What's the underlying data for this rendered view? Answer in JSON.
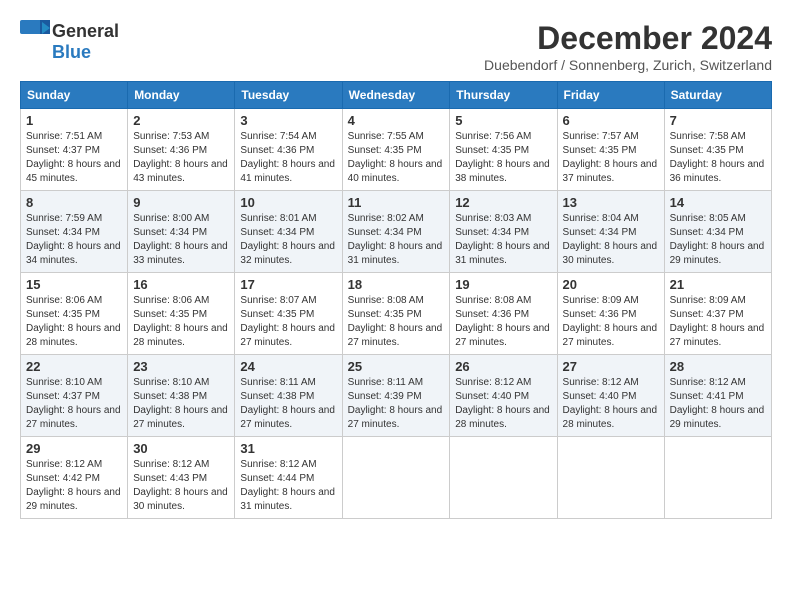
{
  "logo": {
    "general": "General",
    "blue": "Blue"
  },
  "title": {
    "month": "December 2024",
    "location": "Duebendorf / Sonnenberg, Zurich, Switzerland"
  },
  "headers": [
    "Sunday",
    "Monday",
    "Tuesday",
    "Wednesday",
    "Thursday",
    "Friday",
    "Saturday"
  ],
  "weeks": [
    [
      {
        "day": "1",
        "sunrise": "Sunrise: 7:51 AM",
        "sunset": "Sunset: 4:37 PM",
        "daylight": "Daylight: 8 hours and 45 minutes."
      },
      {
        "day": "2",
        "sunrise": "Sunrise: 7:53 AM",
        "sunset": "Sunset: 4:36 PM",
        "daylight": "Daylight: 8 hours and 43 minutes."
      },
      {
        "day": "3",
        "sunrise": "Sunrise: 7:54 AM",
        "sunset": "Sunset: 4:36 PM",
        "daylight": "Daylight: 8 hours and 41 minutes."
      },
      {
        "day": "4",
        "sunrise": "Sunrise: 7:55 AM",
        "sunset": "Sunset: 4:35 PM",
        "daylight": "Daylight: 8 hours and 40 minutes."
      },
      {
        "day": "5",
        "sunrise": "Sunrise: 7:56 AM",
        "sunset": "Sunset: 4:35 PM",
        "daylight": "Daylight: 8 hours and 38 minutes."
      },
      {
        "day": "6",
        "sunrise": "Sunrise: 7:57 AM",
        "sunset": "Sunset: 4:35 PM",
        "daylight": "Daylight: 8 hours and 37 minutes."
      },
      {
        "day": "7",
        "sunrise": "Sunrise: 7:58 AM",
        "sunset": "Sunset: 4:35 PM",
        "daylight": "Daylight: 8 hours and 36 minutes."
      }
    ],
    [
      {
        "day": "8",
        "sunrise": "Sunrise: 7:59 AM",
        "sunset": "Sunset: 4:34 PM",
        "daylight": "Daylight: 8 hours and 34 minutes."
      },
      {
        "day": "9",
        "sunrise": "Sunrise: 8:00 AM",
        "sunset": "Sunset: 4:34 PM",
        "daylight": "Daylight: 8 hours and 33 minutes."
      },
      {
        "day": "10",
        "sunrise": "Sunrise: 8:01 AM",
        "sunset": "Sunset: 4:34 PM",
        "daylight": "Daylight: 8 hours and 32 minutes."
      },
      {
        "day": "11",
        "sunrise": "Sunrise: 8:02 AM",
        "sunset": "Sunset: 4:34 PM",
        "daylight": "Daylight: 8 hours and 31 minutes."
      },
      {
        "day": "12",
        "sunrise": "Sunrise: 8:03 AM",
        "sunset": "Sunset: 4:34 PM",
        "daylight": "Daylight: 8 hours and 31 minutes."
      },
      {
        "day": "13",
        "sunrise": "Sunrise: 8:04 AM",
        "sunset": "Sunset: 4:34 PM",
        "daylight": "Daylight: 8 hours and 30 minutes."
      },
      {
        "day": "14",
        "sunrise": "Sunrise: 8:05 AM",
        "sunset": "Sunset: 4:34 PM",
        "daylight": "Daylight: 8 hours and 29 minutes."
      }
    ],
    [
      {
        "day": "15",
        "sunrise": "Sunrise: 8:06 AM",
        "sunset": "Sunset: 4:35 PM",
        "daylight": "Daylight: 8 hours and 28 minutes."
      },
      {
        "day": "16",
        "sunrise": "Sunrise: 8:06 AM",
        "sunset": "Sunset: 4:35 PM",
        "daylight": "Daylight: 8 hours and 28 minutes."
      },
      {
        "day": "17",
        "sunrise": "Sunrise: 8:07 AM",
        "sunset": "Sunset: 4:35 PM",
        "daylight": "Daylight: 8 hours and 27 minutes."
      },
      {
        "day": "18",
        "sunrise": "Sunrise: 8:08 AM",
        "sunset": "Sunset: 4:35 PM",
        "daylight": "Daylight: 8 hours and 27 minutes."
      },
      {
        "day": "19",
        "sunrise": "Sunrise: 8:08 AM",
        "sunset": "Sunset: 4:36 PM",
        "daylight": "Daylight: 8 hours and 27 minutes."
      },
      {
        "day": "20",
        "sunrise": "Sunrise: 8:09 AM",
        "sunset": "Sunset: 4:36 PM",
        "daylight": "Daylight: 8 hours and 27 minutes."
      },
      {
        "day": "21",
        "sunrise": "Sunrise: 8:09 AM",
        "sunset": "Sunset: 4:37 PM",
        "daylight": "Daylight: 8 hours and 27 minutes."
      }
    ],
    [
      {
        "day": "22",
        "sunrise": "Sunrise: 8:10 AM",
        "sunset": "Sunset: 4:37 PM",
        "daylight": "Daylight: 8 hours and 27 minutes."
      },
      {
        "day": "23",
        "sunrise": "Sunrise: 8:10 AM",
        "sunset": "Sunset: 4:38 PM",
        "daylight": "Daylight: 8 hours and 27 minutes."
      },
      {
        "day": "24",
        "sunrise": "Sunrise: 8:11 AM",
        "sunset": "Sunset: 4:38 PM",
        "daylight": "Daylight: 8 hours and 27 minutes."
      },
      {
        "day": "25",
        "sunrise": "Sunrise: 8:11 AM",
        "sunset": "Sunset: 4:39 PM",
        "daylight": "Daylight: 8 hours and 27 minutes."
      },
      {
        "day": "26",
        "sunrise": "Sunrise: 8:12 AM",
        "sunset": "Sunset: 4:40 PM",
        "daylight": "Daylight: 8 hours and 28 minutes."
      },
      {
        "day": "27",
        "sunrise": "Sunrise: 8:12 AM",
        "sunset": "Sunset: 4:40 PM",
        "daylight": "Daylight: 8 hours and 28 minutes."
      },
      {
        "day": "28",
        "sunrise": "Sunrise: 8:12 AM",
        "sunset": "Sunset: 4:41 PM",
        "daylight": "Daylight: 8 hours and 29 minutes."
      }
    ],
    [
      {
        "day": "29",
        "sunrise": "Sunrise: 8:12 AM",
        "sunset": "Sunset: 4:42 PM",
        "daylight": "Daylight: 8 hours and 29 minutes."
      },
      {
        "day": "30",
        "sunrise": "Sunrise: 8:12 AM",
        "sunset": "Sunset: 4:43 PM",
        "daylight": "Daylight: 8 hours and 30 minutes."
      },
      {
        "day": "31",
        "sunrise": "Sunrise: 8:12 AM",
        "sunset": "Sunset: 4:44 PM",
        "daylight": "Daylight: 8 hours and 31 minutes."
      },
      null,
      null,
      null,
      null
    ]
  ]
}
